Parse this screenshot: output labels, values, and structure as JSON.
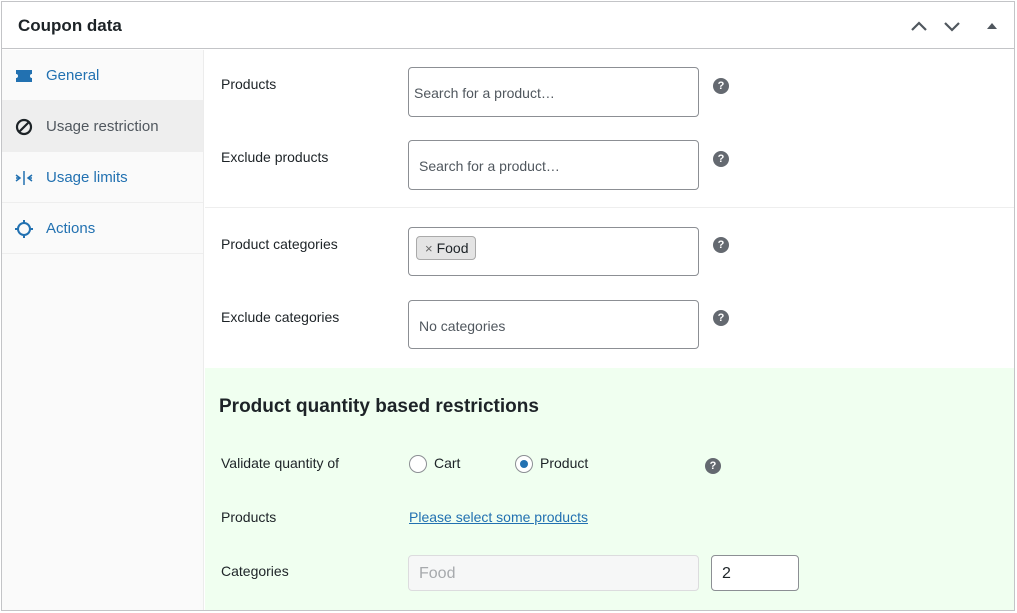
{
  "panel": {
    "title": "Coupon data",
    "controls": [
      "chevron-up-icon",
      "chevron-down-icon",
      "triangle-up-icon"
    ]
  },
  "sidebar": {
    "items": [
      {
        "label": "General",
        "icon": "ticket-icon",
        "active": false
      },
      {
        "label": "Usage restriction",
        "icon": "no-entry-icon",
        "active": true
      },
      {
        "label": "Usage limits",
        "icon": "arrows-in-icon",
        "active": false
      },
      {
        "label": "Actions",
        "icon": "gear-outline-icon",
        "active": false
      }
    ]
  },
  "restrictions": {
    "products": {
      "label": "Products",
      "placeholder": "Search for a product…"
    },
    "exclude_products": {
      "label": "Exclude products",
      "placeholder": "Search for a product…"
    },
    "product_categories": {
      "label": "Product categories",
      "selected": [
        "Food"
      ],
      "remove_symbol": "×"
    },
    "exclude_categories": {
      "label": "Exclude categories",
      "placeholder": "No categories"
    },
    "help_symbol": "?"
  },
  "quantity": {
    "title": "Product quantity based restrictions",
    "validate_label": "Validate quantity of",
    "options": [
      {
        "label": "Cart",
        "checked": false
      },
      {
        "label": "Product",
        "checked": true
      }
    ],
    "products_label": "Products",
    "products_link": "Please select some products",
    "categories_label": "Categories",
    "category_name": "Food",
    "category_qty": "2"
  },
  "colors": {
    "accent": "#2271b1",
    "section_bg": "#f0fff0",
    "border": "#c3c4c7"
  }
}
